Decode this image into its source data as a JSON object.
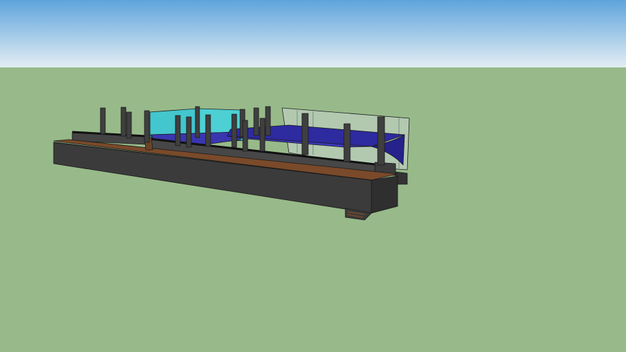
{
  "scene": {
    "colors": {
      "sky_top": "#5ea4dc",
      "sky_bottom": "#dfeaf1",
      "ground": "#98ba8a",
      "hull": "#3b3b3b",
      "hull_top": "#4a4a4a",
      "deck": "#7a4a2a",
      "post": "#3f3f3f",
      "cyan_glass": "#34c8d8",
      "canopy": "#2e2aa0",
      "glass": "#c9d6cf"
    }
  }
}
